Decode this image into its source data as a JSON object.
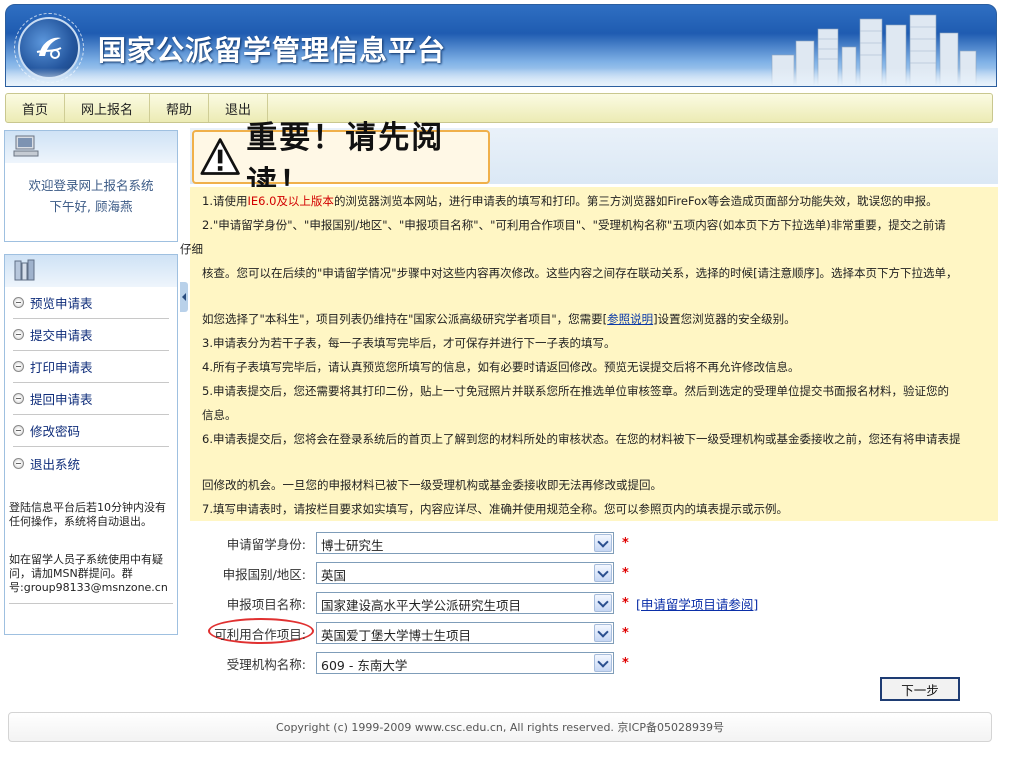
{
  "header": {
    "site_title": "国家公派留学管理信息平台",
    "logo_icon": "csc-logo-icon"
  },
  "nav": {
    "items": [
      "首页",
      "网上报名",
      "帮助",
      "退出"
    ]
  },
  "sidebar": {
    "welcome_line1": "欢迎登录网上报名系统",
    "welcome_line2": "下午好, 顾海燕",
    "menu": [
      "预览申请表",
      "提交申请表",
      "打印申请表",
      "提回申请表",
      "修改密码",
      "退出系统"
    ],
    "note_timeout": "登陆信息平台后若10分钟内没有任何操作，系统将自动退出。",
    "note_help": "如在留学人员子系统使用中有疑问，请加MSN群提问。群号:group98133@msnzone.cn"
  },
  "notice": {
    "title": "重要！请先阅读！",
    "l1_a": "1.请使用",
    "l1_red": "IE6.0及以上版本",
    "l1_b": "的浏览器浏览本网站，进行申请表的填写和打印。第三方浏览器如FireFox等会造成页面部分功能失效，耽误您的申报。",
    "l2": "2.\"申请留学身份\"、\"申报国别/地区\"、\"申报项目名称\"、\"可利用合作项目\"、\"受理机构名称\"五项内容(如本页下方下拉选单)非常重要，提交之前请",
    "l2_wrap": "仔细",
    "l2_cont": "核查。您可以在后续的\"申请留学情况\"步骤中对这些内容再次修改。这些内容之间存在联动关系，选择的时候[请注意顺序]。选择本页下方下拉选单，",
    "l2_d_a": "如您选择了\"本科生\"，项目列表仍维持在\"国家公派高级研究学者项目\"，您需要[",
    "l2_d_link": "参照说明",
    "l2_d_b": "]设置您浏览器的安全级别。",
    "l3": "3.申请表分为若干子表，每一子表填写完毕后，才可保存并进行下一子表的填写。",
    "l4": "4.所有子表填写完毕后，请认真预览您所填写的信息，如有必要时请返回修改。预览无误提交后将不再允许修改信息。",
    "l5": "5.申请表提交后，您还需要将其打印二份，贴上一寸免冠照片并联系您所在推选单位审核签章。然后到选定的受理单位提交书面报名材料，验证您的",
    "l5_b": "信息。",
    "l6": "6.申请表提交后，您将会在登录系统后的首页上了解到您的材料所处的审核状态。在您的材料被下一级受理机构或基金委接收之前，您还有将申请表提",
    "l6_b": "回修改的机会。一旦您的申报材料已被下一级受理机构或基金委接收即无法再修改或提回。",
    "l7": "7.填写申请表时，请按栏目要求如实填写，内容应详尽、准确并使用规范全称。您可以参照页内的填表提示或示例。"
  },
  "form": {
    "rows": [
      {
        "label": "申请留学身份:",
        "value": "博士研究生"
      },
      {
        "label": "申报国别/地区:",
        "value": "英国"
      },
      {
        "label": "申报项目名称:",
        "value": "国家建设高水平大学公派研究生项目"
      },
      {
        "label": "可利用合作项目:",
        "value": "英国爱丁堡大学博士生项目"
      },
      {
        "label": "受理机构名称:",
        "value": "609 - 东南大学"
      }
    ],
    "required_mark": "*",
    "project_link": "[申请留学项目请参阅]",
    "next_label": "下一步"
  },
  "footer": {
    "copyright": "Copyright (c) 1999-2009 www.csc.edu.cn,  All rights reserved.   京ICP备05028939号"
  },
  "colors": {
    "banner": "#1f5cb1",
    "notice_bg": "#fff6c4",
    "required": "#e00000",
    "link": "#0b3aa8"
  }
}
